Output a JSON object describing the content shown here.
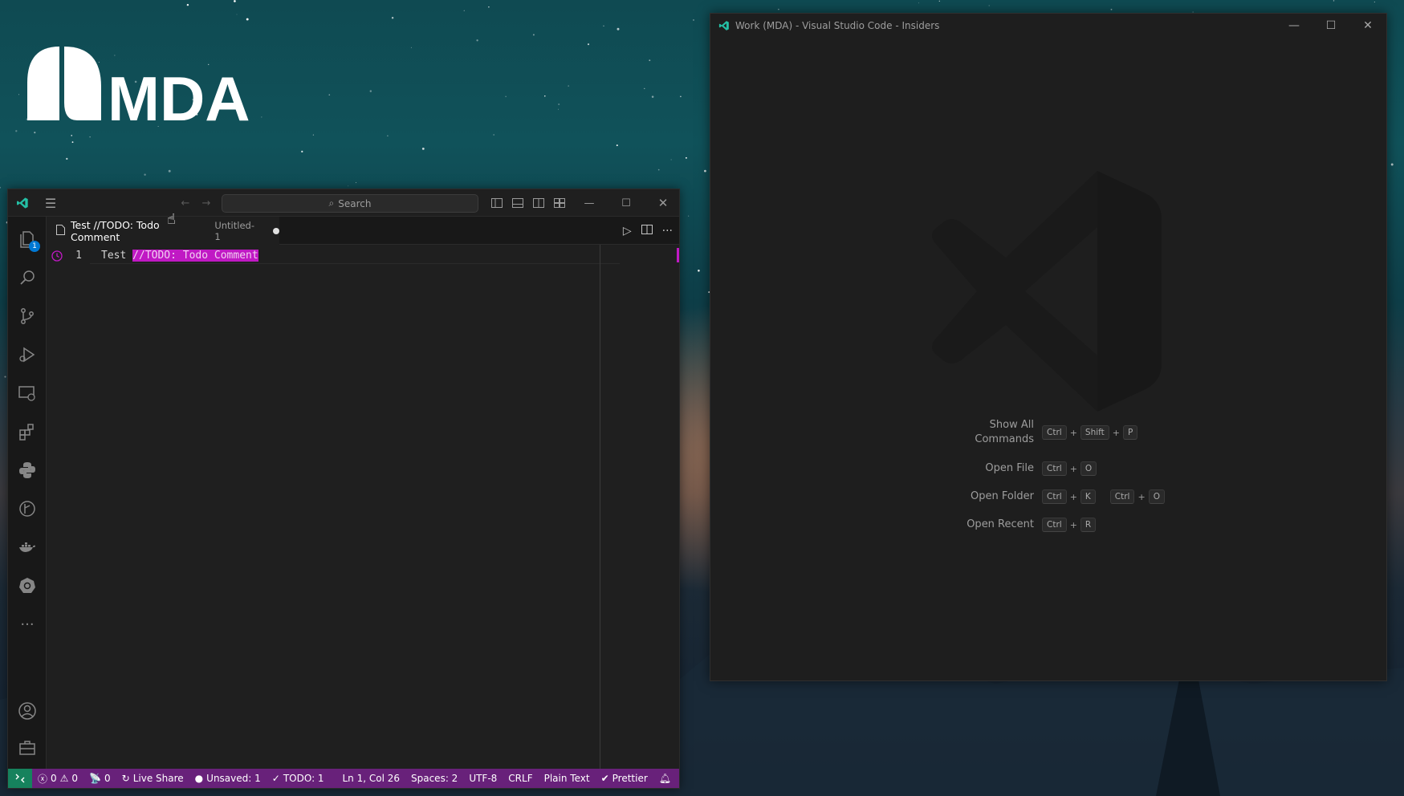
{
  "logo": {
    "text": "MDA"
  },
  "left_window": {
    "titlebar": {
      "search_placeholder": "Search",
      "icons": [
        "vscode-insiders-icon",
        "menu-icon",
        "back-arrow-icon",
        "forward-arrow-icon",
        "search-icon",
        "toggle-primary-sidebar-icon",
        "toggle-panel-icon",
        "toggle-secondary-sidebar-icon",
        "customize-layout-icon",
        "minimize-icon",
        "maximize-icon",
        "close-icon"
      ]
    },
    "activity_bar": {
      "explorer_badge": "1",
      "items": [
        "explorer-icon",
        "search-icon",
        "source-control-icon",
        "run-debug-icon",
        "remote-explorer-icon",
        "extensions-icon",
        "python-icon",
        "git-graph-icon",
        "docker-icon",
        "kubernetes-icon",
        "more-icon",
        "accounts-icon",
        "toolbox-icon"
      ]
    },
    "tab": {
      "title": "Test //TODO: Todo Comment",
      "description": "Untitled-1",
      "dirty": true
    },
    "editor": {
      "line_number": "1",
      "text_before": "Test ",
      "highlight": "//TODO: Todo Comment"
    },
    "status_bar": {
      "errors": "0",
      "warnings": "0",
      "ports": "0",
      "live_share": "Live Share",
      "unsaved": "Unsaved: 1",
      "todo": "TODO: 1",
      "position": "Ln 1, Col 26",
      "spaces": "Spaces: 2",
      "encoding": "UTF-8",
      "eol": "CRLF",
      "language": "Plain Text",
      "prettier": "Prettier"
    },
    "colors": {
      "status_bar": "#68217a",
      "remote": "#16825d",
      "highlight": "#c019c4"
    }
  },
  "right_window": {
    "title": "Work (MDA) - Visual Studio Code - Insiders",
    "shortcuts": [
      {
        "label": "Show All Commands",
        "keys": [
          [
            "Ctrl",
            "Shift",
            "P"
          ]
        ]
      },
      {
        "label": "Open File",
        "keys": [
          [
            "Ctrl",
            "O"
          ]
        ]
      },
      {
        "label": "Open Folder",
        "keys": [
          [
            "Ctrl",
            "K"
          ],
          [
            "Ctrl",
            "O"
          ]
        ]
      },
      {
        "label": "Open Recent",
        "keys": [
          [
            "Ctrl",
            "R"
          ]
        ]
      }
    ]
  }
}
